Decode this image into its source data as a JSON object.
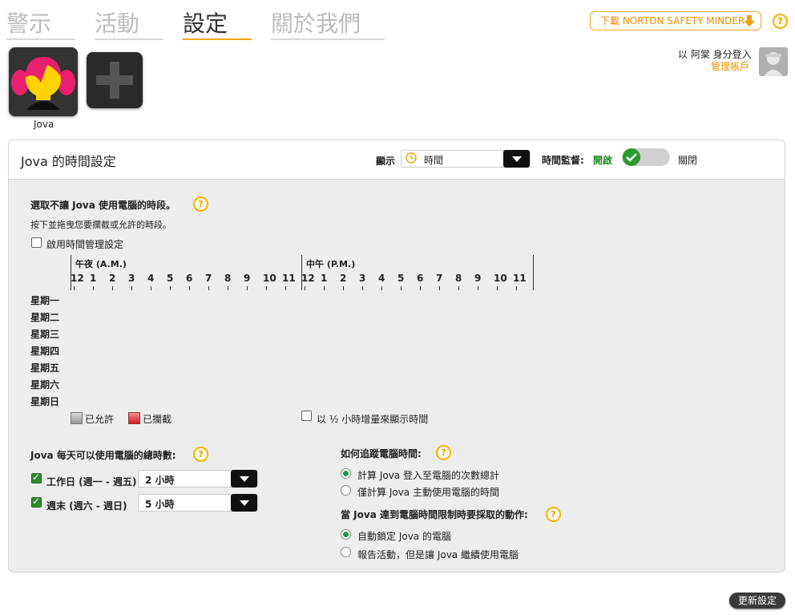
{
  "tabs": [
    {
      "label": "警示"
    },
    {
      "label": "活動"
    },
    {
      "label": "設定"
    },
    {
      "label": "關於我們"
    }
  ],
  "header": {
    "download_label": "下載 NORTON SAFETY MINDER",
    "login_text": "以 阿棠 身分登入",
    "manage_account": "管理帳戶"
  },
  "children": [
    {
      "name": "Jova"
    }
  ],
  "panel": {
    "title": "Jova 的時間設定",
    "display_label": "顯示",
    "display_value": "時間",
    "monitor_label": "時間監督:",
    "monitor_on": "開啟",
    "monitor_off": "關閉",
    "monitor_enabled": true
  },
  "schedule": {
    "heading": "選取不讓 Jova 使用電腦的時段。",
    "instructions": "按下並拖曳您要攔截或允許的時段。",
    "enable_label": "啟用時間管理設定",
    "enable_checked": false,
    "am_label": "午夜 (A.M.)",
    "pm_label": "中午 (P.M.)",
    "hours": [
      "12",
      "1",
      "2",
      "3",
      "4",
      "5",
      "6",
      "7",
      "8",
      "9",
      "10",
      "11",
      "12",
      "1",
      "2",
      "3",
      "4",
      "5",
      "6",
      "7",
      "8",
      "9",
      "10",
      "11"
    ],
    "days": [
      "星期一",
      "星期二",
      "星期三",
      "星期四",
      "星期五",
      "星期六",
      "星期日"
    ],
    "legend_allowed": "已允許",
    "legend_blocked": "已攔截",
    "half_hour_label": "以 ½ 小時增量來顯示時間",
    "half_hour_checked": false
  },
  "daily_limit": {
    "heading": "Jova 每天可以使用電腦的總時數:",
    "weekday_label": "工作日 (週一 - 週五)",
    "weekday_checked": true,
    "weekday_value": "2 小時",
    "weekend_label": "週末 (週六 - 週日)",
    "weekend_checked": true,
    "weekend_value": "5 小時"
  },
  "tracking": {
    "heading": "如何追蹤電腦時間:",
    "option1": "計算 Jova 登入至電腦的次數總計",
    "option2": "僅計算 Jova 主動使用電腦的時間",
    "selected": 1
  },
  "action": {
    "heading": "當 Jova 達到電腦時間限制時要採取的動作:",
    "option1": "自動鎖定 Jova 的電腦",
    "option2": "報告活動，但是讓 Jova 繼續使用電腦",
    "selected": 1
  },
  "footer": {
    "update_label": "更新設定"
  },
  "colors": {
    "accent": "#f4a500",
    "on_green": "#1a8a1a",
    "blocked": "#e04040"
  }
}
